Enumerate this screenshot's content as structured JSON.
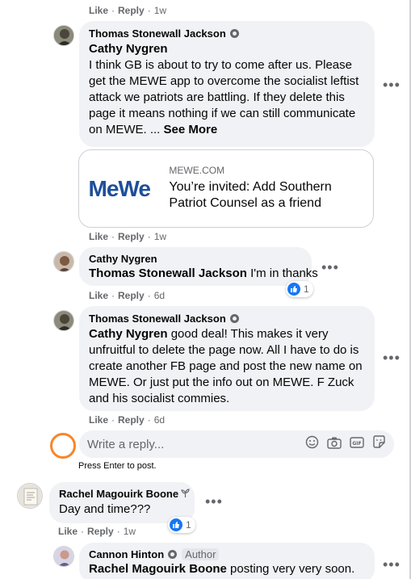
{
  "top_meta": {
    "like": "Like",
    "reply": "Reply",
    "time": "1w"
  },
  "comments": [
    {
      "author": "Thomas Stonewall Jackson",
      "mention": "Cathy Nygren",
      "text": "I think GB is about to try to come after us. Please get the MEWE app to overcome the socialist leftist attack we patriots are battling. If they delete this page it means nothing if we can still communicate on MEWE. ...",
      "see_more": "See More",
      "link_preview": {
        "logo": "MeWe",
        "domain": "MEWE.COM",
        "title": "You’re invited: Add Southern Patriot Counsel as a friend"
      },
      "like": "Like",
      "reply": "Reply",
      "time": "1w"
    },
    {
      "author": "Cathy Nygren",
      "mention": "Thomas Stonewall Jackson",
      "text": "I'm in thanks",
      "reaction_count": "1",
      "like": "Like",
      "reply": "Reply",
      "time": "6d"
    },
    {
      "author": "Thomas Stonewall Jackson",
      "mention": "Cathy Nygren",
      "text": "good deal! This makes it very unfruitful to delete the page now. All I have to do is create another FB page and post the new name on MEWE. Or just put the info out on MEWE. F Zuck and his socialist commies.",
      "like": "Like",
      "reply": "Reply",
      "time": "6d"
    }
  ],
  "reply_box": {
    "placeholder": "Write a reply...",
    "hint": "Press Enter to post."
  },
  "comment_rachel": {
    "author": "Rachel Magouirk Boone",
    "text": "Day and time???",
    "reaction_count": "1",
    "like": "Like",
    "reply": "Reply",
    "time": "1w"
  },
  "comment_cannon": {
    "author": "Cannon Hinton",
    "badge": "Author",
    "mention": "Rachel Magouirk Boone",
    "text": "posting very very soon."
  },
  "colors": {
    "like_blue": "#1877f2",
    "highlight_orange": "#f7862a",
    "bubble_bg": "#f0f2f5"
  }
}
